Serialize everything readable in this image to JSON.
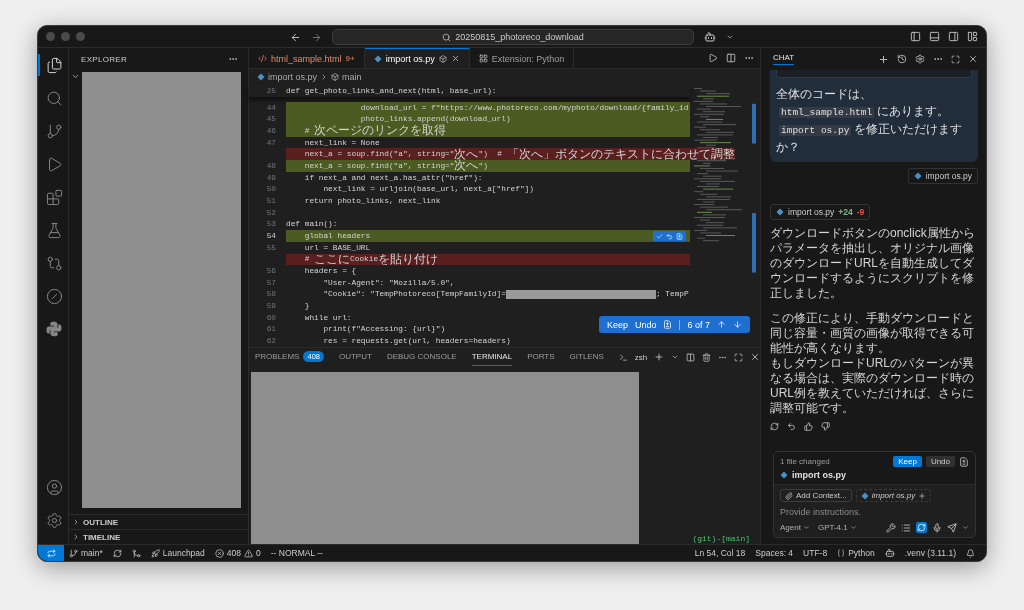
{
  "window": {
    "search": "20250815_photoreco_download"
  },
  "activity_bar": {
    "items": [
      {
        "kind": "explorer",
        "selected": true
      },
      {
        "kind": "search",
        "selected": false
      },
      {
        "kind": "scm",
        "selected": false
      },
      {
        "kind": "run",
        "selected": false
      },
      {
        "kind": "extensions",
        "selected": false
      },
      {
        "kind": "testing",
        "selected": false
      },
      {
        "kind": "gitlens",
        "selected": false
      },
      {
        "kind": "remote",
        "selected": false
      },
      {
        "kind": "python",
        "selected": false
      }
    ],
    "bottom": [
      {
        "kind": "accounts"
      },
      {
        "kind": "settings"
      }
    ]
  },
  "sidebar": {
    "title": "EXPLORER",
    "sections": [
      {
        "label": "OUTLINE",
        "expanded": false
      },
      {
        "label": "TIMELINE",
        "expanded": false
      }
    ]
  },
  "tabs": [
    {
      "label": "html_sample.html",
      "badge": "9+",
      "kind": "html",
      "selected": false
    },
    {
      "label": "import os.py",
      "kind": "python",
      "selected": true
    },
    {
      "label": "Extension: Python",
      "kind": "extension",
      "selected": false
    }
  ],
  "breadcrumb": [
    {
      "label": "import os.py",
      "kind": "python"
    },
    {
      "label": "main",
      "kind": "symbol"
    }
  ],
  "code": {
    "sticky": {
      "number": "25",
      "text": "def get_photo_links_and_next(html, base_url):"
    },
    "lines": [
      {
        "number": "44",
        "text": "                download_url = f\"https://www.photoreco.com/myphoto/download/{family_id",
        "kind": "added"
      },
      {
        "number": "45",
        "text": "                photo_links.append(download_url)",
        "kind": "added"
      },
      {
        "number": "46",
        "text": "    # 次ページのリンクを取得",
        "kind": "added"
      },
      {
        "number": "47",
        "text": "    next_link = None",
        "kind": "context"
      },
      {
        "text": "    next_a = soup.find(\"a\", string=\"次へ\")  # 「次へ」ボタンのテキストに合わせて調整",
        "kind": "deleted"
      },
      {
        "number": "48",
        "text": "    next_a = soup.find(\"a\", string=\"次へ\")",
        "kind": "added"
      },
      {
        "number": "49",
        "text": "    if next_a and next_a.has_attr(\"href\"):",
        "kind": "context"
      },
      {
        "number": "50",
        "text": "        next_link = urljoin(base_url, next_a[\"href\"])",
        "kind": "context"
      },
      {
        "number": "51",
        "text": "    return photo_links, next_link",
        "kind": "context"
      },
      {
        "number": "52",
        "kind": "context"
      },
      {
        "number": "53",
        "text": "def main():",
        "kind": "context"
      },
      {
        "number": "54",
        "text": "    global headers",
        "kind": "added",
        "current": true,
        "actions": true
      },
      {
        "number": "55",
        "text": "    url = BASE_URL",
        "kind": "context",
        "current": false
      },
      {
        "text": "    # ここにCookieを貼り付け",
        "kind": "deleted"
      },
      {
        "number": "56",
        "text": "    headers = {",
        "kind": "context"
      },
      {
        "number": "57",
        "text": "        \"User-Agent\": \"Mozilla/5.0\",",
        "kind": "context"
      },
      {
        "number": "58",
        "text": "        \"Cookie\": \"TempPhotoreco[TempFamilyId]=",
        "text_after": "; TempP",
        "kind": "context"
      },
      {
        "number": "59",
        "text": "    }",
        "kind": "context"
      },
      {
        "number": "60",
        "text": "    while url:",
        "kind": "context"
      },
      {
        "number": "61",
        "text": "        print(f\"Accessing: {url}\")",
        "kind": "context"
      },
      {
        "number": "62",
        "text": "        res = requests.get(url, headers=headers)",
        "kind": "context"
      }
    ]
  },
  "diff_nav": {
    "keep": "Keep",
    "undo": "Undo",
    "position": "6 of 7"
  },
  "panel": {
    "tabs": [
      {
        "label": "PROBLEMS",
        "badge": "408",
        "selected": false
      },
      {
        "label": "OUTPUT",
        "selected": false
      },
      {
        "label": "DEBUG CONSOLE",
        "selected": false
      },
      {
        "label": "TERMINAL",
        "selected": true
      },
      {
        "label": "PORTS",
        "selected": false
      },
      {
        "label": "GITLENS",
        "selected": false
      }
    ],
    "shell": "zsh",
    "prompt": "(git)-[main]"
  },
  "chat": {
    "title": "CHAT",
    "request": {
      "lines": [
        [
          {
            "kind": "text",
            "text": "全体のコードは、"
          },
          {
            "kind": "code",
            "text": "html_sample.html"
          },
          {
            "kind": "text",
            "text": "にあります。"
          }
        ],
        [
          {
            "kind": "code",
            "text": "import os.py"
          },
          {
            "kind": "text",
            "text": "を修正いただけますか？"
          }
        ]
      ],
      "attachment": "import os.py"
    },
    "response": {
      "file": "import os.py",
      "added": "+24",
      "removed": "-9",
      "paragraphs": [
        [
          "ダウンロードボタンのonclick属性からパラメータを抽出し、オリジナル画像のダウンロードURLを自動生成してダウンロードするようにスクリプトを修正しました。"
        ],
        [
          "この修正により、手動ダウンロードと同じ容量・画質の画像が取得できる可能性が高くなります。",
          "もしダウンロードURLのパターンが異なる場合は、実際のダウンロード時のURL例を教えていただければ、さらに調整可能です。"
        ]
      ]
    },
    "changes": {
      "summary": "1 file changed",
      "keep": "Keep",
      "undo": "Undo",
      "file": "import os.py"
    },
    "input": {
      "add_context": "Add Context...",
      "context_file": "import os.py",
      "placeholder": "Provide instructions.",
      "mode": "Agent",
      "model": "GPT-4.1",
      "auto_approve": true
    }
  },
  "status_bar": {
    "branch": "main*",
    "launchpad": "Launchpad",
    "errors": "408",
    "warnings": "0",
    "mode": "-- NORMAL --",
    "right": [
      {
        "kind": "text",
        "text": "Ln 54, Col 18"
      },
      {
        "kind": "text",
        "text": "Spaces: 4"
      },
      {
        "kind": "text",
        "text": "UTF-8"
      },
      {
        "kind": "language",
        "text": "Python"
      },
      {
        "kind": "copilot"
      },
      {
        "kind": "text",
        "text": ".venv (3.11.1)"
      },
      {
        "kind": "bell"
      }
    ]
  }
}
